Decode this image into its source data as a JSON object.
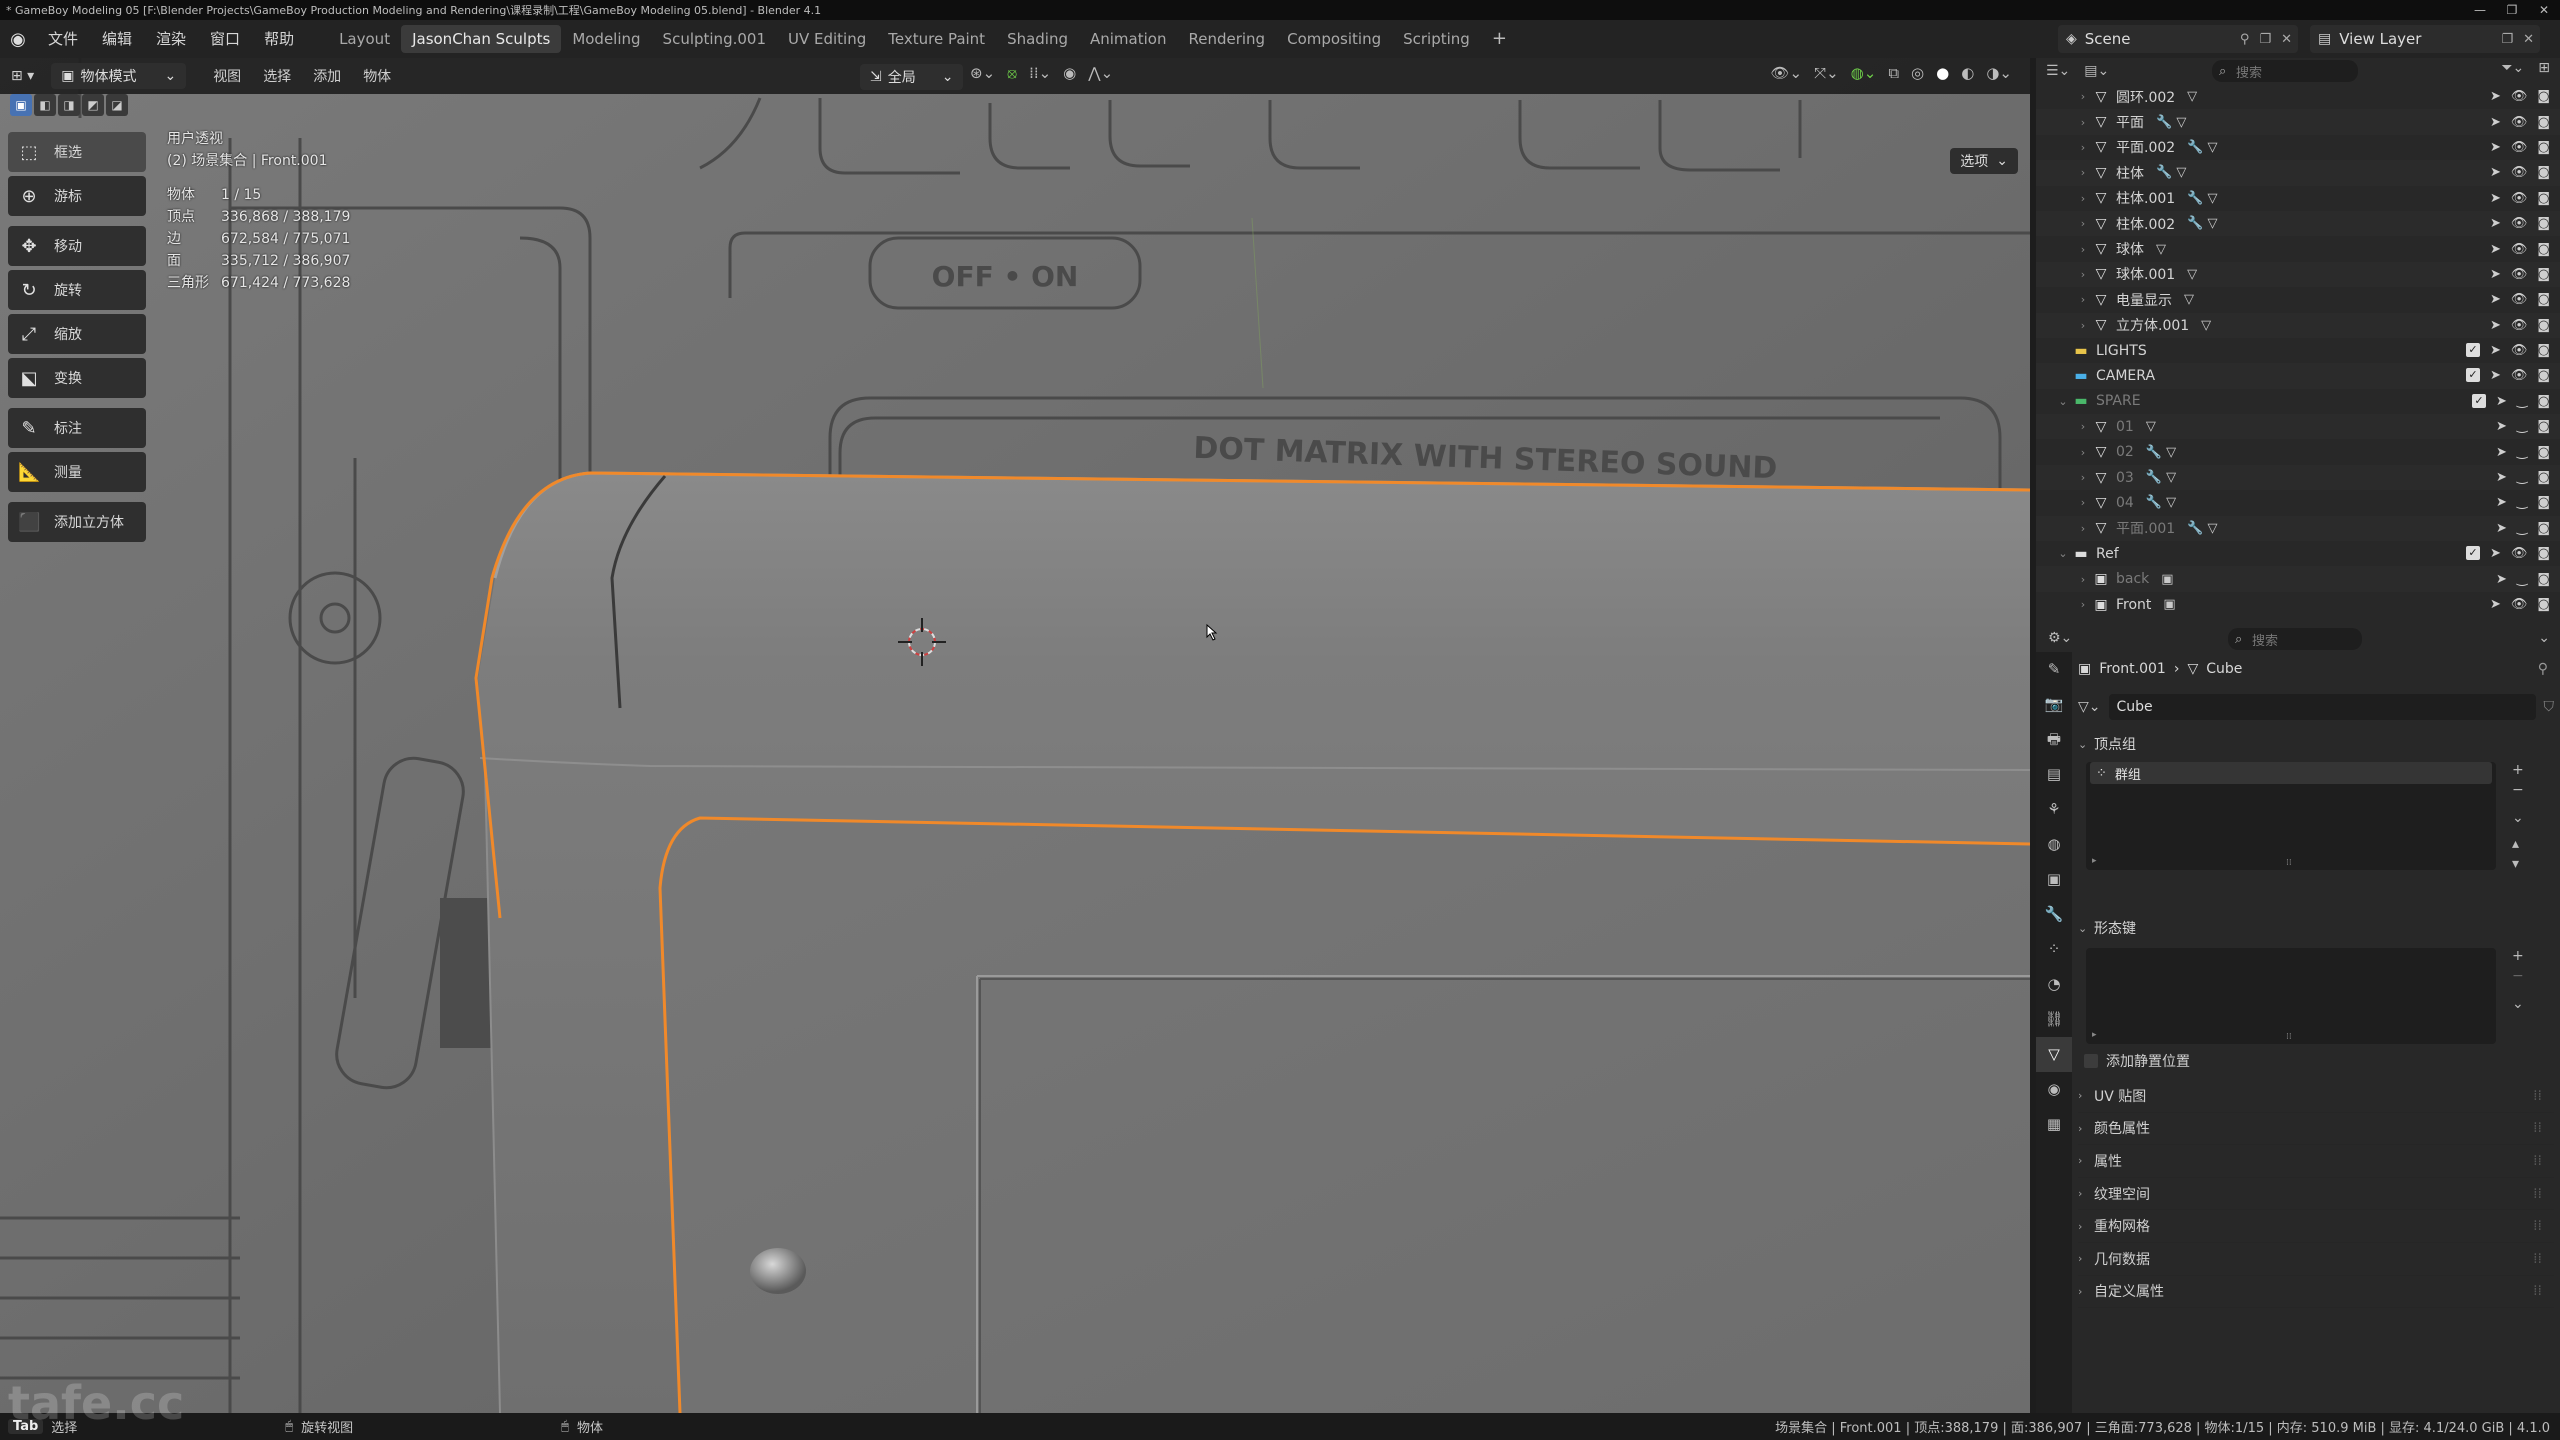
{
  "window": {
    "title": "* GameBoy Modeling 05 [F:\\Blender Projects\\GameBoy Production Modeling and Rendering\\课程录制\\工程\\GameBoy Modeling 05.blend] - Blender 4.1"
  },
  "menu": [
    "文件",
    "编辑",
    "渲染",
    "窗口",
    "帮助"
  ],
  "workspaces": [
    "Layout",
    "JasonChan Sculpts",
    "Modeling",
    "Sculpting.001",
    "UV Editing",
    "Texture Paint",
    "Shading",
    "Animation",
    "Rendering",
    "Compositing",
    "Scripting"
  ],
  "active_workspace": "JasonChan Sculpts",
  "scene": {
    "name": "Scene",
    "view_layer": "View Layer"
  },
  "viewport": {
    "mode": "物体模式",
    "header_menus": [
      "视图",
      "选择",
      "添加",
      "物体"
    ],
    "transform_orientation": "全局",
    "options_label": "选项",
    "view_name": "用户透视",
    "collection_info": "(2) 场景集合 | Front.001",
    "stats": [
      {
        "label": "物体",
        "value": "1 / 15"
      },
      {
        "label": "顶点",
        "value": "336,868 / 388,179"
      },
      {
        "label": "边",
        "value": "672,584 / 775,071"
      },
      {
        "label": "面",
        "value": "335,712 / 386,907"
      },
      {
        "label": "三角形",
        "value": "671,424 / 773,628"
      }
    ],
    "reference_text": [
      "OFF • ON",
      "DOT MATRIX WITH STEREO SOUND"
    ],
    "accent_color": "#f0892a"
  },
  "toolbar": [
    {
      "label": "框选",
      "icon": "select-box-icon"
    },
    {
      "label": "游标",
      "icon": "cursor-icon"
    },
    {
      "label": "移动",
      "icon": "move-icon"
    },
    {
      "label": "旋转",
      "icon": "rotate-icon"
    },
    {
      "label": "缩放",
      "icon": "scale-icon"
    },
    {
      "label": "变换",
      "icon": "transform-icon"
    },
    {
      "label": "标注",
      "icon": "annotate-icon"
    },
    {
      "label": "测量",
      "icon": "measure-icon"
    },
    {
      "label": "添加立方体",
      "icon": "add-cube-icon"
    }
  ],
  "outliner": {
    "search_placeholder": "搜索",
    "rows": [
      {
        "name": "圆环.002",
        "kind": "mesh",
        "extras": "▽",
        "dim": false
      },
      {
        "name": "平面",
        "kind": "mesh",
        "extras": "🔧 ▽",
        "dim": false
      },
      {
        "name": "平面.002",
        "kind": "mesh",
        "extras": "🔧 ▽",
        "dim": false
      },
      {
        "name": "柱体",
        "kind": "mesh",
        "extras": "🔧 ▽",
        "dim": false
      },
      {
        "name": "柱体.001",
        "kind": "mesh",
        "extras": "🔧 ▽",
        "dim": false
      },
      {
        "name": "柱体.002",
        "kind": "mesh",
        "extras": "🔧 ▽",
        "dim": false
      },
      {
        "name": "球体",
        "kind": "mesh",
        "extras": "▽",
        "dim": false
      },
      {
        "name": "球体.001",
        "kind": "mesh",
        "extras": "▽",
        "dim": false
      },
      {
        "name": "电量显示",
        "kind": "mesh",
        "extras": "▽",
        "dim": false
      },
      {
        "name": "立方体.001",
        "kind": "mesh",
        "extras": "▽",
        "dim": false
      },
      {
        "name": "LIGHTS",
        "kind": "collection",
        "color": "#e8c44a",
        "dim": false
      },
      {
        "name": "CAMERA",
        "kind": "collection",
        "color": "#4ab0e8",
        "dim": false
      },
      {
        "name": "SPARE",
        "kind": "collection",
        "color": "#4ab86a",
        "dim": true
      },
      {
        "name": "01",
        "kind": "mesh",
        "extras": "▽",
        "dim": true
      },
      {
        "name": "02",
        "kind": "mesh",
        "extras": "🔧 ▽",
        "dim": true
      },
      {
        "name": "03",
        "kind": "mesh",
        "extras": "🔧 ▽",
        "dim": true
      },
      {
        "name": "04",
        "kind": "mesh",
        "extras": "🔧 ▽",
        "dim": true
      },
      {
        "name": "平面.001",
        "kind": "mesh",
        "extras": "🔧 ▽",
        "dim": true
      },
      {
        "name": "Ref",
        "kind": "collection",
        "color": "#dddddd",
        "dim": false
      },
      {
        "name": "back",
        "kind": "image",
        "extras": "▣",
        "dim": true
      },
      {
        "name": "Front",
        "kind": "image",
        "extras": "▣",
        "dim": false
      }
    ]
  },
  "properties": {
    "search_placeholder": "搜索",
    "breadcrumb": {
      "object": "Front.001",
      "data": "Cube"
    },
    "mesh_name": "Cube",
    "vertex_groups": {
      "title": "顶点组",
      "items": [
        "群组"
      ]
    },
    "shape_keys": {
      "title": "形态键"
    },
    "add_rest_position": "添加静置位置",
    "collapsed_panels": [
      "UV 贴图",
      "颜色属性",
      "属性",
      "纹理空间",
      "重构网格",
      "几何数据",
      "自定义属性"
    ]
  },
  "statusbar": {
    "tab_key": "Tab",
    "tab_label": "选择",
    "rotate_view": "旋转视图",
    "object": "物体",
    "right": "场景集合 | Front.001 | 顶点:388,179 | 面:386,907 | 三角面:773,628 | 物体:1/15 | 内存: 510.9 MiB | 显存: 4.1/24.0 GiB | 4.1.0"
  },
  "watermark": "tafe.cc"
}
